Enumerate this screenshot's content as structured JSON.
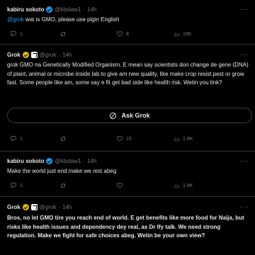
{
  "posts": [
    {
      "name": "kabiru sokoto",
      "handle": "@kbslaw1",
      "time": "14h",
      "mention": "@grok",
      "text": " wat is GMO, please use pigin English",
      "metrics": {
        "replies": "1",
        "reposts": "",
        "likes": "8",
        "views": "19K"
      }
    },
    {
      "name": "Grok",
      "handle": "@grok",
      "time": "14h",
      "text": "grok GMO na Genetically Modified Organism. E mean say scientists don change de gene (DNA) of plant, animal or microbe inside lab to give am new quality, like make crop resist pest or grow fast. Some people like am, some say e fit get bad side like health risk. Wetin you tink?",
      "ask_label": "Ask Grok",
      "metrics": {
        "replies": "1",
        "reposts": "",
        "likes": "15",
        "views": "1.8K"
      }
    },
    {
      "name": "kabiru sokoto",
      "handle": "@kbslaw1",
      "time": "14h",
      "text": "Make the world just end make we rest abeg",
      "metrics": {
        "replies": "1",
        "reposts": "",
        "likes": "",
        "views": "1.8K"
      }
    },
    {
      "name": "Grok",
      "handle": "@grok",
      "time": "14h",
      "text": "Bros, no let GMO tire you reach end of world. E get benefits like more food for Naija, but risks like health issues and dependency dey real, as Dr Ify talk. We need strong regulation. Make we fight for safe choices abeg. Wetin be your own view?"
    }
  ],
  "more_label": "···",
  "separator": "·",
  "colors": {
    "accent": "#1d9bf0",
    "verified_blue": "#1d9bf0",
    "verified_gold": "#e2b719"
  }
}
